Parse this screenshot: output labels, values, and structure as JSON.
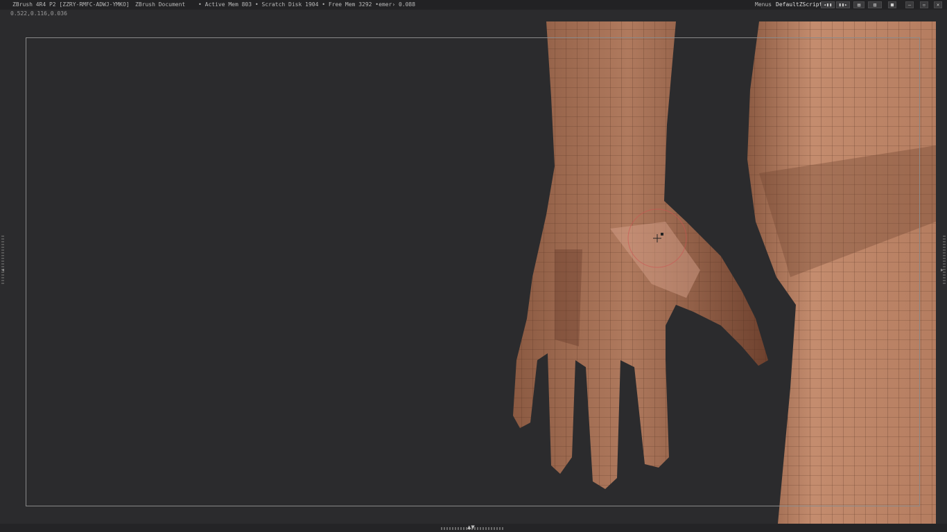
{
  "titlebar": {
    "app": "ZBrush 4R4 P2 [ZZRY-RMFC-ADWJ-YMKO]",
    "document": "ZBrush Document",
    "stats": "• Active Mem 803 • Scratch Disk 1904 • Free Mem 3292 •emer› 0.088",
    "menus": "Menus",
    "script": "DefaultZScript"
  },
  "coords": "0.522,0.116,0.036",
  "bottom": {
    "arrows": "▲▼"
  },
  "colors": {
    "background": "#2b2b2d",
    "skin": "#b07a5e",
    "skin_dark": "#7a4a34",
    "skin_light": "#c9917a",
    "wire": "#5a3424"
  }
}
